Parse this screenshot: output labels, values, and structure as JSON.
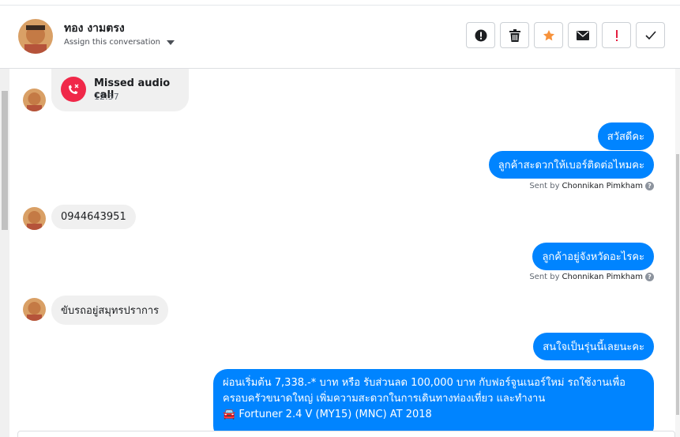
{
  "header": {
    "contact_name": "ทอง งามตรง",
    "assign_label": "Assign this conversation"
  },
  "actions": [
    {
      "icon": "alert-circle-icon",
      "color": "#1c1e21"
    },
    {
      "icon": "trash-icon",
      "color": "#1c1e21"
    },
    {
      "icon": "star-icon",
      "color": "#f7923b"
    },
    {
      "icon": "envelope-icon",
      "color": "#1c1e21"
    },
    {
      "icon": "exclamation-icon",
      "color": "#e41e3f"
    },
    {
      "icon": "checkmark-icon",
      "color": "#1c1e21"
    }
  ],
  "messages": {
    "missed_call": {
      "title": "Missed audio call",
      "time": "12:57"
    },
    "out_greeting": "สวัสดีคะ",
    "out_ask_number": "ลูกค้าสะดวกให้เบอร์ติดต่อไหมคะ",
    "sent_by_1": {
      "prefix": "Sent by",
      "name": "Chonnikan Pimkham"
    },
    "in_phone": "0944643951",
    "out_ask_province": "ลูกค้าอยู่จังหวัดอะไรคะ",
    "sent_by_2": {
      "prefix": "Sent by",
      "name": "Chonnikan Pimkham"
    },
    "in_location": "ขับรถอยู่สมุทรปราการ",
    "out_interest": "สนใจเป็นรุ่นนี้เลยนะคะ",
    "out_promo_line1": "ผ่อนเริ่มต้น 7,338.-* บาท หรือ รับส่วนลด 100,000 บาท กับฟอร์จูนเนอร์ใหม่ รถใช้งานเพื่อ",
    "out_promo_line2": "ครอบครัวขนาดใหญ่ เพิ่มความสะดวกในการเดินทางท่องเที่ยว และทำงาน",
    "out_promo_line3": "🚘 Fortuner 2.4 V (MY15) (MNC) AT 2018"
  },
  "colors": {
    "outgoing_bubble": "#0084ff",
    "incoming_bubble": "#f0f0f0",
    "missed_call_icon": "#f02849"
  }
}
